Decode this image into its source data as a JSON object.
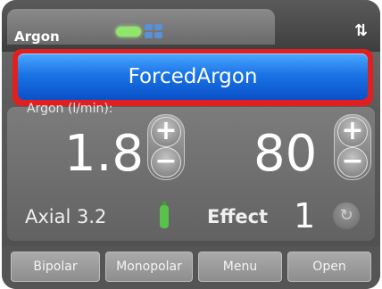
{
  "header": {
    "mode_title": "Argon",
    "sort_icon": "⇅"
  },
  "mode_bar": {
    "label": "ForcedArgon"
  },
  "flow": {
    "label": "Argon (l/min):",
    "value": "1.8"
  },
  "power": {
    "value": "80"
  },
  "buttons": {
    "plus": "+",
    "minus": "−"
  },
  "axial": {
    "label": "Axial 3.2"
  },
  "effect": {
    "label": "Effect",
    "value": "1",
    "cycle_icon": "↻"
  },
  "tabs": [
    {
      "label": "Bipolar"
    },
    {
      "label": "Monopolar"
    },
    {
      "label": "Menu"
    },
    {
      "label": "Open"
    }
  ],
  "colors": {
    "mode_bar": "#1a74e6",
    "highlight_border": "#e02020",
    "indicator_green": "#8fe66a",
    "indicator_blue": "#5b8fd6",
    "bottle_green": "#58c24a"
  },
  "icons": {
    "status_green": "status-indicator-green",
    "status_blue": "status-indicator-blue",
    "bottle": "argon-bottle-icon",
    "cycle": "cycle-icon"
  }
}
